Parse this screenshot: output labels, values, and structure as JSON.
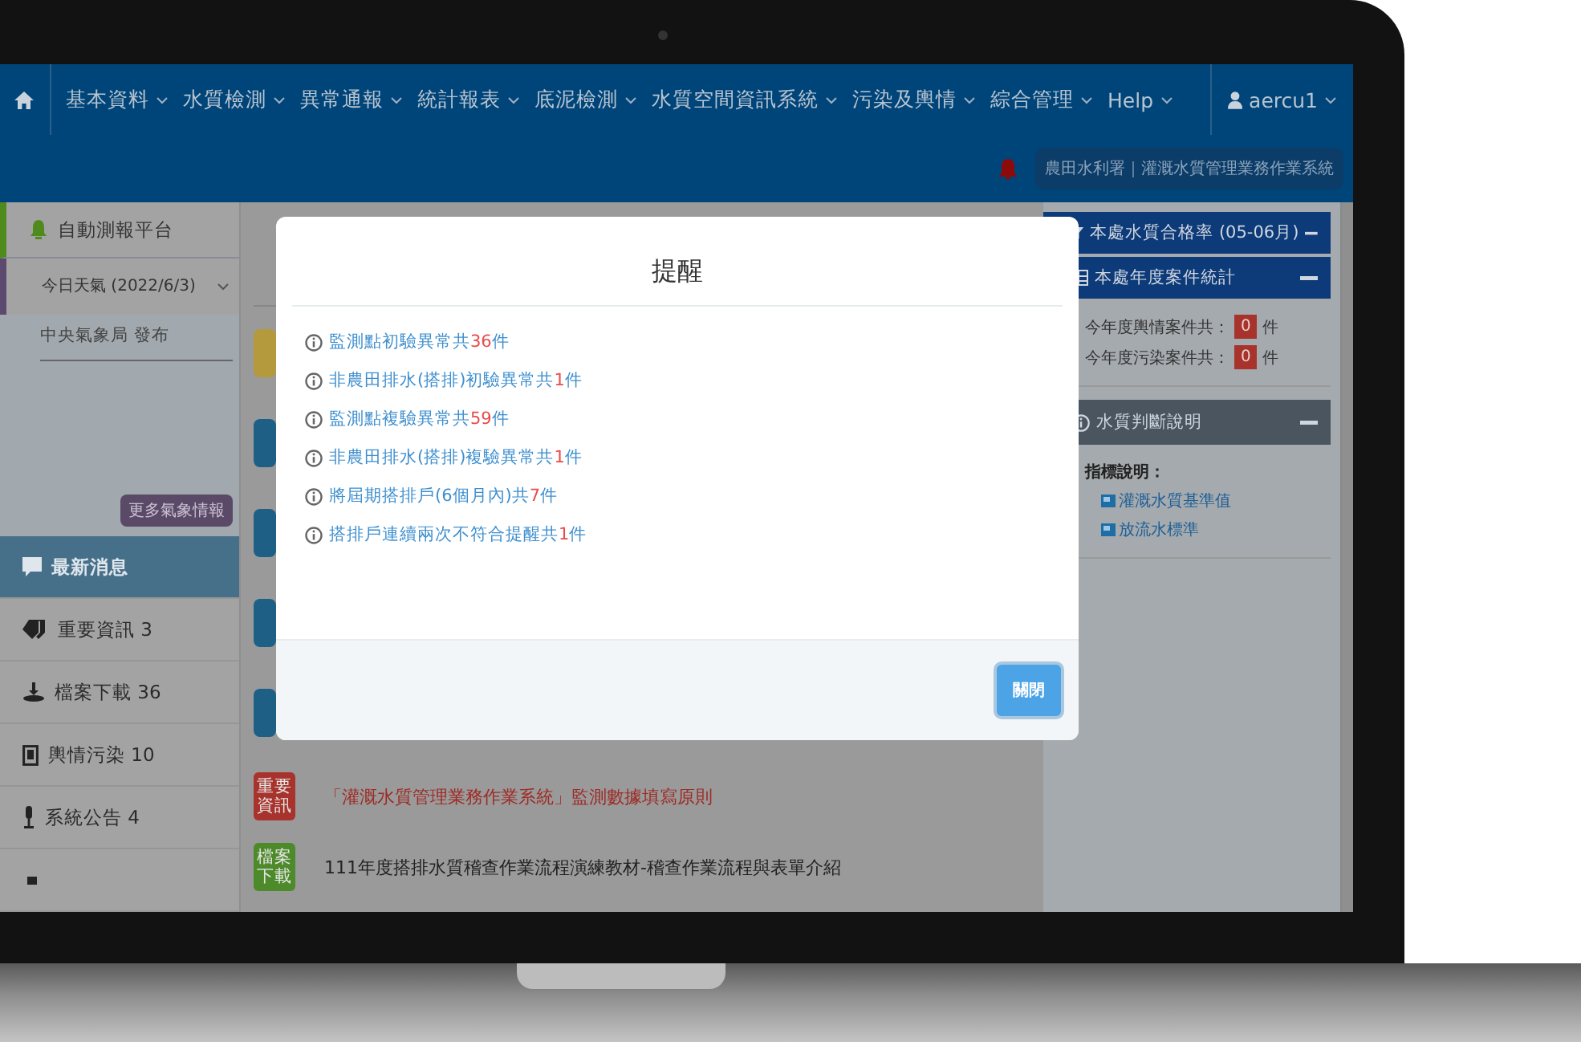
{
  "navbar": {
    "items": [
      {
        "label": "基本資料"
      },
      {
        "label": "水質檢測"
      },
      {
        "label": "異常通報"
      },
      {
        "label": "統計報表"
      },
      {
        "label": "底泥檢測"
      },
      {
        "label": "水質空間資訊系統"
      },
      {
        "label": "污染及輿情"
      },
      {
        "label": "綜合管理"
      },
      {
        "label": "Help"
      }
    ],
    "user": "aercu1"
  },
  "system_label": "農田水利署｜灌溉水質管理業務作業系統",
  "sidebar": {
    "platform": "自動測報平台",
    "weather": {
      "title": "今日天氣 (2022/6/3)",
      "source": "中央氣象局 發布",
      "more_button": "更多氣象情報"
    },
    "menu": [
      {
        "kind": "news",
        "label": "最新消息",
        "selected": true
      },
      {
        "kind": "tag",
        "label": "重要資訊 3",
        "selected": false
      },
      {
        "kind": "download",
        "label": "檔案下載 36",
        "selected": false
      },
      {
        "kind": "doc",
        "label": "輿情污染 10",
        "selected": false
      },
      {
        "kind": "mic",
        "label": "系統公告 4",
        "selected": false
      },
      {
        "kind": "calendar",
        "selected": false
      }
    ]
  },
  "main": {
    "hidden_badges": [
      {
        "color": "#b49a3c"
      },
      {
        "color": "#1e5f86"
      },
      {
        "color": "#1e5f86"
      },
      {
        "color": "#1e5f86"
      },
      {
        "color": "#1e5f86"
      }
    ],
    "news": [
      {
        "kind": "important",
        "badge": "重要資訊",
        "title": "「灌溉水質管理業務作業系統」監測數據填寫原則"
      },
      {
        "kind": "download",
        "badge": "檔案下載",
        "title": "111年度搭排水質稽查作業流程演練教材-稽查作業流程與表單介紹"
      }
    ]
  },
  "right_panel": {
    "panels": [
      {
        "kind": "rate",
        "title": "本處水質合格率 (05-06月)"
      },
      {
        "kind": "stats",
        "title": "本處年度案件統計",
        "rows": [
          {
            "label": "今年度輿情案件共：",
            "count": "0",
            "unit": "件"
          },
          {
            "label": "今年度污染案件共：",
            "count": "0",
            "unit": "件"
          }
        ]
      },
      {
        "kind": "info",
        "title": "水質判斷說明",
        "label": "指標說明：",
        "links": [
          "灌溉水質基準值",
          "放流水標準"
        ]
      }
    ]
  },
  "modal": {
    "title": "提醒",
    "items": [
      {
        "before": "監測點初驗異常共",
        "count": "36",
        "after": "件"
      },
      {
        "before": "非農田排水(搭排)初驗異常共",
        "count": "1",
        "after": "件"
      },
      {
        "before": "監測點複驗異常共",
        "count": "59",
        "after": "件"
      },
      {
        "before": "非農田排水(搭排)複驗異常共",
        "count": "1",
        "after": "件"
      },
      {
        "before": "將屆期搭排戶(6個月內)共",
        "count": "7",
        "after": "件"
      },
      {
        "before": "搭排戶連續兩次不符合提醒共",
        "count": "1",
        "after": "件"
      }
    ],
    "close_button": "關閉"
  }
}
